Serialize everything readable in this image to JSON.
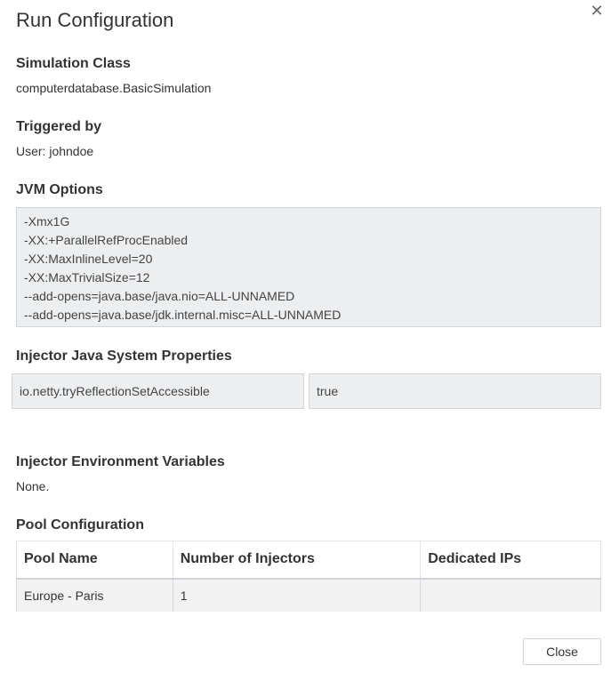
{
  "dialog": {
    "title": "Run Configuration",
    "close_icon": "close-icon"
  },
  "simulation_class": {
    "heading": "Simulation Class",
    "value": "computerdatabase.BasicSimulation"
  },
  "triggered_by": {
    "heading": "Triggered by",
    "value": "User: johndoe"
  },
  "jvm_options": {
    "heading": "JVM Options",
    "lines": [
      "-Xmx1G",
      "-XX:+ParallelRefProcEnabled",
      "-XX:MaxInlineLevel=20",
      "-XX:MaxTrivialSize=12",
      "--add-opens=java.base/java.nio=ALL-UNNAMED",
      "--add-opens=java.base/jdk.internal.misc=ALL-UNNAMED"
    ]
  },
  "system_properties": {
    "heading": "Injector Java System Properties",
    "items": [
      {
        "key": "io.netty.tryReflectionSetAccessible",
        "value": "true"
      }
    ]
  },
  "env_variables": {
    "heading": "Injector Environment Variables",
    "value": "None."
  },
  "pool_configuration": {
    "heading": "Pool Configuration",
    "columns": [
      "Pool Name",
      "Number of Injectors",
      "Dedicated IPs"
    ],
    "rows": [
      [
        "Europe - Paris",
        "1",
        ""
      ]
    ]
  },
  "footer": {
    "close_label": "Close"
  },
  "colors": {
    "field_background": "#eceef0",
    "field_border": "#d2d5d9",
    "row_background": "#f2f2f2"
  }
}
